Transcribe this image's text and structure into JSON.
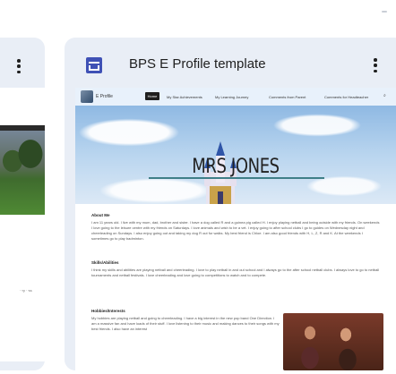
{
  "left_card": {
    "tiny_text": "··ry\n··ss"
  },
  "main_card": {
    "title": "BPS E Profile template",
    "icon": "sites-document-icon"
  },
  "site": {
    "name": "E Profile",
    "nav": {
      "home": "Home",
      "items": [
        "My Star Achievements",
        "My Learning Journey",
        "Comments from Parent",
        "Comments for Headteacher"
      ]
    },
    "hero_title": "MRS JONES",
    "sections": [
      {
        "heading": "About Me",
        "text": "I am 11 years old. I live with my mum, dad, brother and sister. I have a dog called R and a guinea pig called H. I enjoy playing netball and being outside with my friends. On weekends I love going to the leisure centre with my friends on Saturdays. I love animals and wish to be a vet. I enjoy going to after school clubs I go to guides on Wednesday night and cheerleading on Sundays. I also enjoy going out and taking my dog R out for walks. My best friend is Chloe. I am also good friends with H, L, Z, R and K. At the weekends I sometimes go to play badminton."
      },
      {
        "heading": "Skills/Abilities",
        "text": "I think my skills and abilities are playing netball and cheerleading. I love to play netball in and out school and I always go to the after school netball clubs. I always love to go to netball tournaments and netball festivals. I love cheerleading and love going to competitions to watch and to compete."
      },
      {
        "heading": "Hobbies/Interests",
        "text": "My hobbies are playing netball and going to cheerleading. I have a big interest in the new pop band One Direction. I am a massive fan and have loads of their stuff. I love listening to their music and making dances to their songs with my best friends. I also have an interest"
      }
    ]
  }
}
